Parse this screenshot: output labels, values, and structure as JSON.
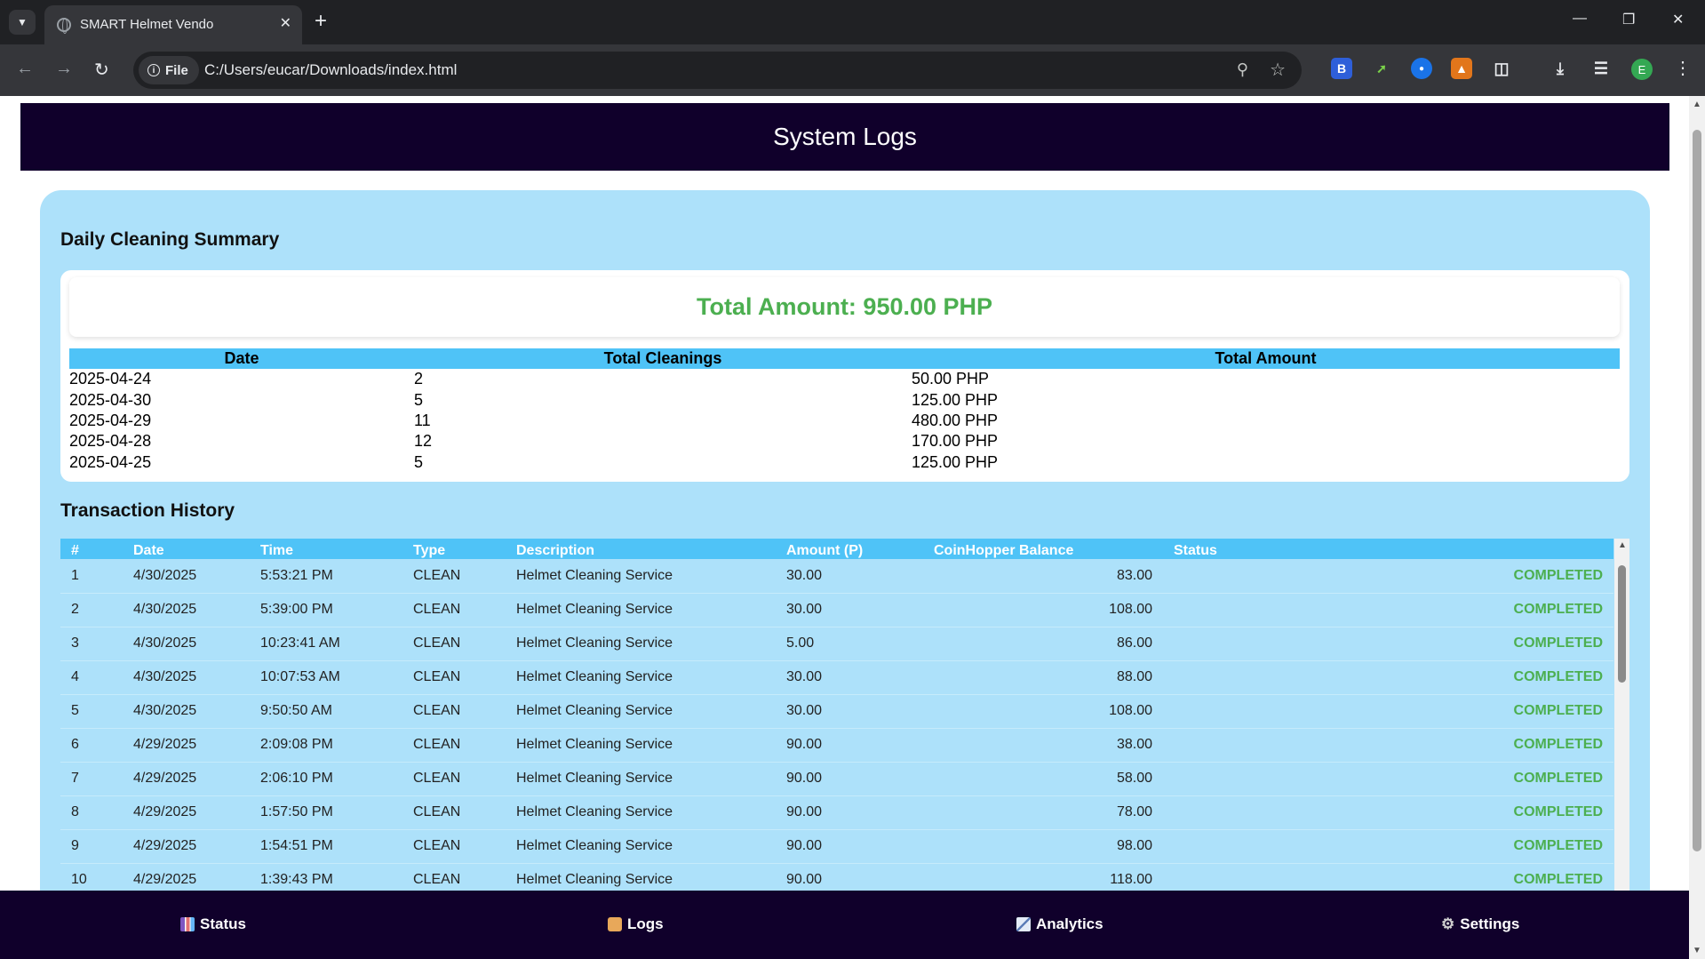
{
  "browser": {
    "tab_title": "SMART Helmet Vendo",
    "file_chip": "File",
    "url": "C:/Users/eucar/Downloads/index.html",
    "profile_initial": "E"
  },
  "header": {
    "title": "System Logs"
  },
  "summary": {
    "heading": "Daily Cleaning Summary",
    "total_amount": "Total Amount: 950.00 PHP",
    "columns": [
      "Date",
      "Total Cleanings",
      "Total Amount"
    ],
    "rows": [
      [
        "2025-04-24",
        "2",
        "50.00 PHP"
      ],
      [
        "2025-04-30",
        "5",
        "125.00 PHP"
      ],
      [
        "2025-04-29",
        "11",
        "480.00 PHP"
      ],
      [
        "2025-04-28",
        "12",
        "170.00 PHP"
      ],
      [
        "2025-04-25",
        "5",
        "125.00 PHP"
      ]
    ]
  },
  "transactions": {
    "heading": "Transaction History",
    "columns": [
      "#",
      "Date",
      "Time",
      "Type",
      "Description",
      "Amount (P)",
      "CoinHopper Balance",
      "Status"
    ],
    "rows": [
      [
        "1",
        "4/30/2025",
        "5:53:21 PM",
        "CLEAN",
        "Helmet Cleaning Service",
        "30.00",
        "83.00",
        "COMPLETED"
      ],
      [
        "2",
        "4/30/2025",
        "5:39:00 PM",
        "CLEAN",
        "Helmet Cleaning Service",
        "30.00",
        "108.00",
        "COMPLETED"
      ],
      [
        "3",
        "4/30/2025",
        "10:23:41 AM",
        "CLEAN",
        "Helmet Cleaning Service",
        "5.00",
        "86.00",
        "COMPLETED"
      ],
      [
        "4",
        "4/30/2025",
        "10:07:53 AM",
        "CLEAN",
        "Helmet Cleaning Service",
        "30.00",
        "88.00",
        "COMPLETED"
      ],
      [
        "5",
        "4/30/2025",
        "9:50:50 AM",
        "CLEAN",
        "Helmet Cleaning Service",
        "30.00",
        "108.00",
        "COMPLETED"
      ],
      [
        "6",
        "4/29/2025",
        "2:09:08 PM",
        "CLEAN",
        "Helmet Cleaning Service",
        "90.00",
        "38.00",
        "COMPLETED"
      ],
      [
        "7",
        "4/29/2025",
        "2:06:10 PM",
        "CLEAN",
        "Helmet Cleaning Service",
        "90.00",
        "58.00",
        "COMPLETED"
      ],
      [
        "8",
        "4/29/2025",
        "1:57:50 PM",
        "CLEAN",
        "Helmet Cleaning Service",
        "90.00",
        "78.00",
        "COMPLETED"
      ],
      [
        "9",
        "4/29/2025",
        "1:54:51 PM",
        "CLEAN",
        "Helmet Cleaning Service",
        "90.00",
        "98.00",
        "COMPLETED"
      ],
      [
        "10",
        "4/29/2025",
        "1:39:43 PM",
        "CLEAN",
        "Helmet Cleaning Service",
        "90.00",
        "118.00",
        "COMPLETED"
      ]
    ]
  },
  "bottom_nav": [
    {
      "label": "Status",
      "icon": "bar-chart-icon",
      "color": "#7e57c2"
    },
    {
      "label": "Logs",
      "icon": "scroll-icon",
      "color": "#e8a85a"
    },
    {
      "label": "Analytics",
      "icon": "line-chart-icon",
      "color": "#9ab2d8"
    },
    {
      "label": "Settings",
      "icon": "gear-icon",
      "color": "#cfcfcf"
    }
  ],
  "colors": {
    "header_bg": "#10002b",
    "panel_bg": "#ade1fa",
    "table_header": "#4fc3f7",
    "success": "#4caf50"
  }
}
